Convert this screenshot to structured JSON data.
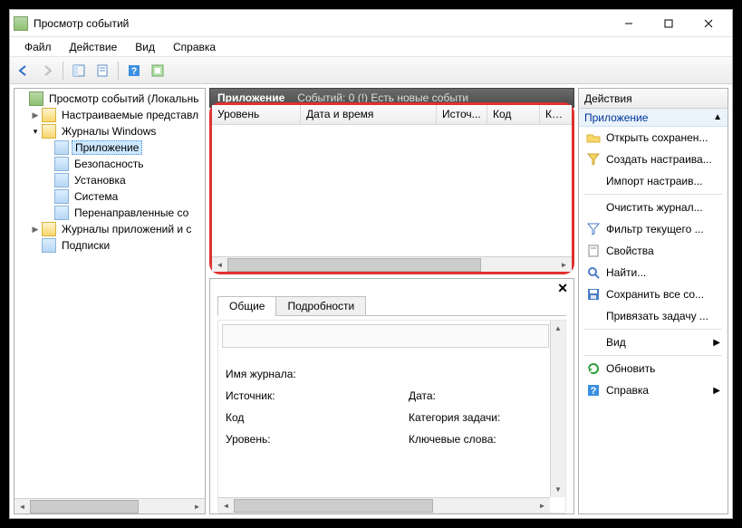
{
  "window": {
    "title": "Просмотр событий"
  },
  "menu": [
    "Файл",
    "Действие",
    "Вид",
    "Справка"
  ],
  "tree": {
    "root": "Просмотр событий (Локальнь",
    "node_custom": "Настраиваемые представл",
    "node_winlogs": "Журналы Windows",
    "leaf_app": "Приложение",
    "leaf_sec": "Безопасность",
    "leaf_setup": "Установка",
    "leaf_sys": "Система",
    "leaf_fwd": "Перенаправленные со",
    "node_applogs": "Журналы приложений и с",
    "node_subs": "Подписки"
  },
  "center": {
    "title": "Приложение",
    "subtitle": "Событий: 0 (!) Есть новые событи",
    "cols": {
      "level": "Уровень",
      "datetime": "Дата и время",
      "source": "Источ...",
      "code": "Код со...",
      "cat": "Катег"
    }
  },
  "details": {
    "tab_general": "Общие",
    "tab_details": "Подробности",
    "f_logname": "Имя журнала:",
    "f_source": "Источник:",
    "f_code": "Код",
    "f_level": "Уровень:",
    "f_date": "Дата:",
    "f_taskcat": "Категория задачи:",
    "f_keywords": "Ключевые слова:"
  },
  "actions": {
    "title": "Действия",
    "subtitle": "Приложение",
    "a_open": "Открыть сохранен...",
    "a_create": "Создать настраива...",
    "a_import": "Импорт настраив...",
    "a_clear": "Очистить журнал...",
    "a_filter": "Фильтр текущего ...",
    "a_props": "Свойства",
    "a_find": "Найти...",
    "a_saveall": "Сохранить все со...",
    "a_attach": "Привязать задачу ...",
    "a_view": "Вид",
    "a_refresh": "Обновить",
    "a_help": "Справка"
  }
}
